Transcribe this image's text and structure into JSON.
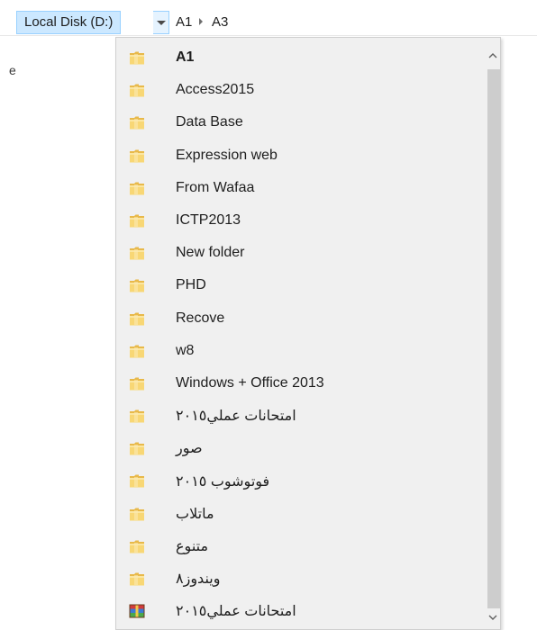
{
  "address_bar": {
    "drive_label": "Local Disk (D:)",
    "crumbs": [
      "A1",
      "A3"
    ]
  },
  "left_pane": {
    "partial_text": "e"
  },
  "dropdown": {
    "items": [
      {
        "label": "A1",
        "icon": "folder-icon",
        "bold": true
      },
      {
        "label": "Access2015",
        "icon": "folder-icon"
      },
      {
        "label": "Data Base",
        "icon": "folder-icon"
      },
      {
        "label": "Expression web",
        "icon": "folder-icon"
      },
      {
        "label": "From Wafaa",
        "icon": "folder-icon"
      },
      {
        "label": "ICTP2013",
        "icon": "folder-icon"
      },
      {
        "label": "New folder",
        "icon": "folder-icon"
      },
      {
        "label": "PHD",
        "icon": "folder-icon"
      },
      {
        "label": "Recove",
        "icon": "folder-icon"
      },
      {
        "label": "w8",
        "icon": "folder-icon"
      },
      {
        "label": "Windows + Office 2013",
        "icon": "folder-icon"
      },
      {
        "label": "امتحانات عملي٢٠١٥",
        "icon": "folder-icon"
      },
      {
        "label": "صور",
        "icon": "folder-icon"
      },
      {
        "label": "فوتوشوب ٢٠١٥",
        "icon": "folder-icon"
      },
      {
        "label": "ماتلاب",
        "icon": "folder-icon"
      },
      {
        "label": "متنوع",
        "icon": "folder-icon"
      },
      {
        "label": "ويندوز٨",
        "icon": "folder-icon"
      },
      {
        "label": "امتحانات عملي٢٠١٥",
        "icon": "archive-icon"
      }
    ]
  },
  "colors": {
    "crumb_selected_bg": "#cce8ff",
    "crumb_selected_border": "#99d1ff",
    "dropdown_bg": "#f0f0f0",
    "folder_yellow": "#f8d775",
    "scroll_thumb": "#cdcdcd"
  }
}
